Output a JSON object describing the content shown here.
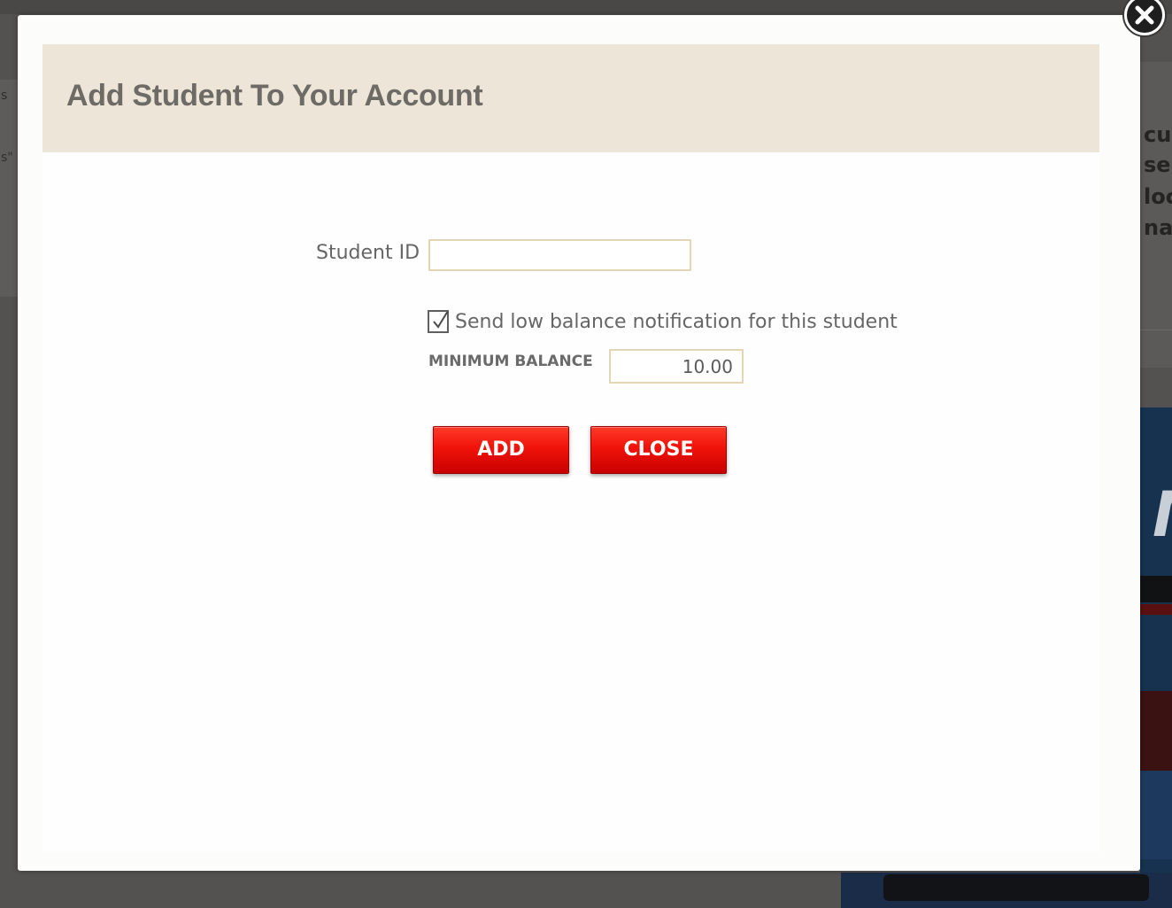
{
  "modal": {
    "title": "Add Student To Your Account",
    "close_icon": "close-icon"
  },
  "form": {
    "student_id_label": "Student ID",
    "student_id_value": "",
    "notify_checked": true,
    "notify_label": "Send low balance notification for this student",
    "min_balance_label": "MINIMUM BALANCE",
    "min_balance_value": "10.00"
  },
  "buttons": {
    "add_label": "ADD",
    "close_label": "CLOSE"
  },
  "background_fragments": {
    "left": [
      "s",
      "s\""
    ],
    "right": [
      "cur",
      "se d",
      "loc",
      "nat"
    ],
    "promo_letter": "M"
  },
  "colors": {
    "button_red": "#e8140a",
    "header_band": "#ede6d8",
    "input_border": "#e3d6b4",
    "overlay": "#545250"
  }
}
